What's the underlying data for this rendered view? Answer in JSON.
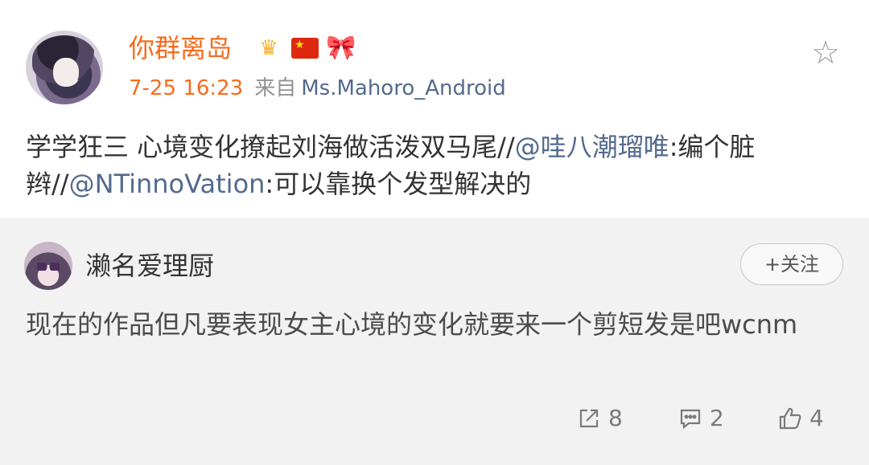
{
  "post": {
    "username": "你群离岛",
    "badges": [
      "crown-badge",
      "china-flag-badge",
      "bow-badge"
    ],
    "crown_level": "5",
    "time": "7-25 16:23",
    "from_label": "来自",
    "source": "Ms.Mahoro_Android",
    "text_before_1": "学学狂三 心境变化撩起刘海做活泼双马尾//",
    "mention_1": "@哇八潮瑠唯",
    "text_between": ":编个脏辫//",
    "mention_2": "@NTinnoVation",
    "text_after": ":可以靠换个发型解决的",
    "favorite_icon": "star-icon"
  },
  "repost": {
    "username": "濑名爱理厨",
    "follow_label": "+关注",
    "text": "现在的作品但凡要表现女主心境的变化就要来一个剪短发是吧wcnm",
    "actions": {
      "repost_count": "8",
      "comment_count": "2",
      "like_count": "4"
    }
  },
  "colors": {
    "username_orange": "#f76b1c",
    "mention_blue": "#536a8e",
    "repost_bg": "#f2f2f2",
    "muted_text": "#929292"
  }
}
